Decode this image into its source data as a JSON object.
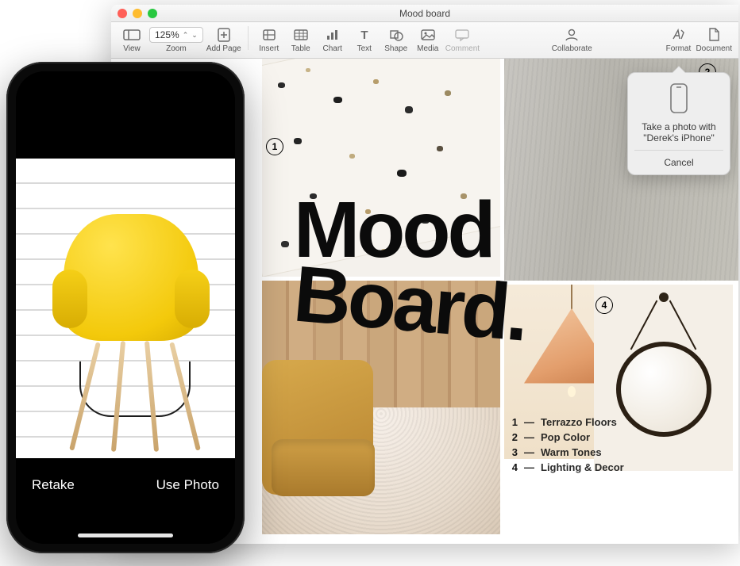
{
  "window": {
    "title": "Mood board"
  },
  "toolbar": {
    "view": "View",
    "zoom_value": "125%",
    "zoom_label": "Zoom",
    "add_page": "Add Page",
    "insert": "Insert",
    "table": "Table",
    "chart": "Chart",
    "text": "Text",
    "shape": "Shape",
    "media": "Media",
    "comment": "Comment",
    "collaborate": "Collaborate",
    "format": "Format",
    "document": "Document"
  },
  "canvas": {
    "heading_line1": "Mood",
    "heading_line2": "Board.",
    "badges": {
      "b1": "1",
      "b2": "2",
      "b4": "4"
    },
    "legend": [
      {
        "n": "1",
        "dash": "—",
        "label": "Terrazzo Floors"
      },
      {
        "n": "2",
        "dash": "—",
        "label": "Pop Color"
      },
      {
        "n": "3",
        "dash": "—",
        "label": "Warm Tones"
      },
      {
        "n": "4",
        "dash": "—",
        "label": "Lighting & Decor"
      }
    ]
  },
  "popover": {
    "line1": "Take a photo with",
    "line2": "\"Derek's iPhone\"",
    "cancel": "Cancel"
  },
  "iphone": {
    "retake": "Retake",
    "use_photo": "Use Photo"
  }
}
